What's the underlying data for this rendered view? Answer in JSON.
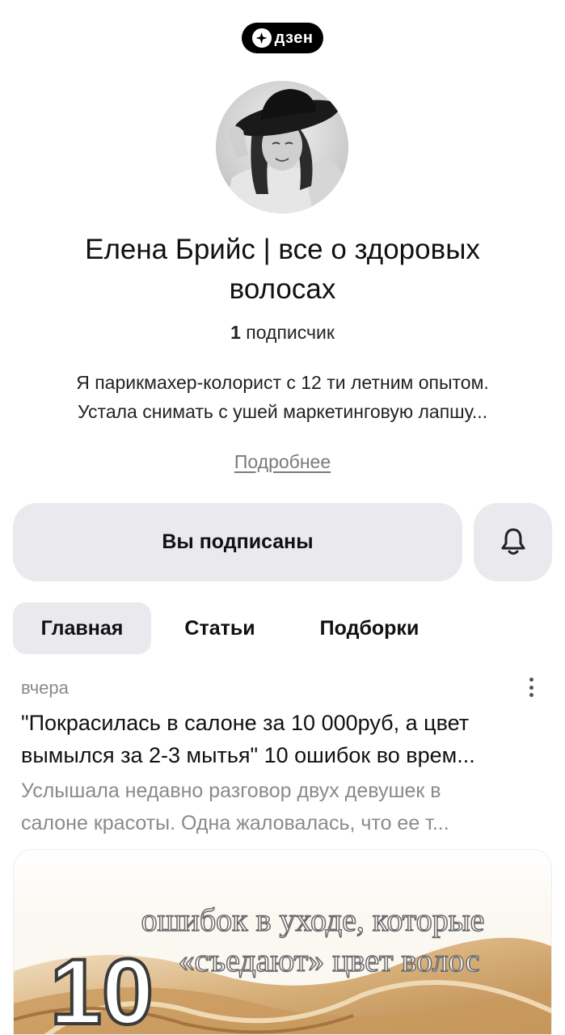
{
  "brand": {
    "logo_text": "дзен"
  },
  "channel": {
    "name": "Елена Брийс | все о здоровых волосах",
    "subscribers_count": "1",
    "subscribers_label": "подписчик",
    "description_line1": "Я парикмахер-колорист с 12 ти летним опытом.",
    "description_line2": "Устала снимать с ушей маркетинговую лапшу...",
    "more_link": "Подробнее"
  },
  "actions": {
    "subscribed_label": "Вы подписаны",
    "bell_icon": "bell-icon"
  },
  "tabs": [
    {
      "label": "Главная",
      "active": true
    },
    {
      "label": "Статьи",
      "active": false
    },
    {
      "label": "Подборки",
      "active": false
    }
  ],
  "post": {
    "date": "вчера",
    "title_line1": "\"Покрасилась в салоне за 10 000руб, а цвет",
    "title_line2": "вымылся за 2-3 мытья\" 10 ошибок во врем...",
    "text_line1": "Услышала недавно разговор двух девушек в",
    "text_line2": "салоне красоты. Одна жаловалась, что ее т...",
    "image": {
      "number": "10",
      "caption_line1": "ошибок в уходе, которые",
      "caption_line2": "«съедают» цвет волос"
    }
  },
  "colors": {
    "button_bg": "#e9e9ee",
    "secondary_text": "#8a8a8a",
    "logo_bg": "#000000"
  }
}
